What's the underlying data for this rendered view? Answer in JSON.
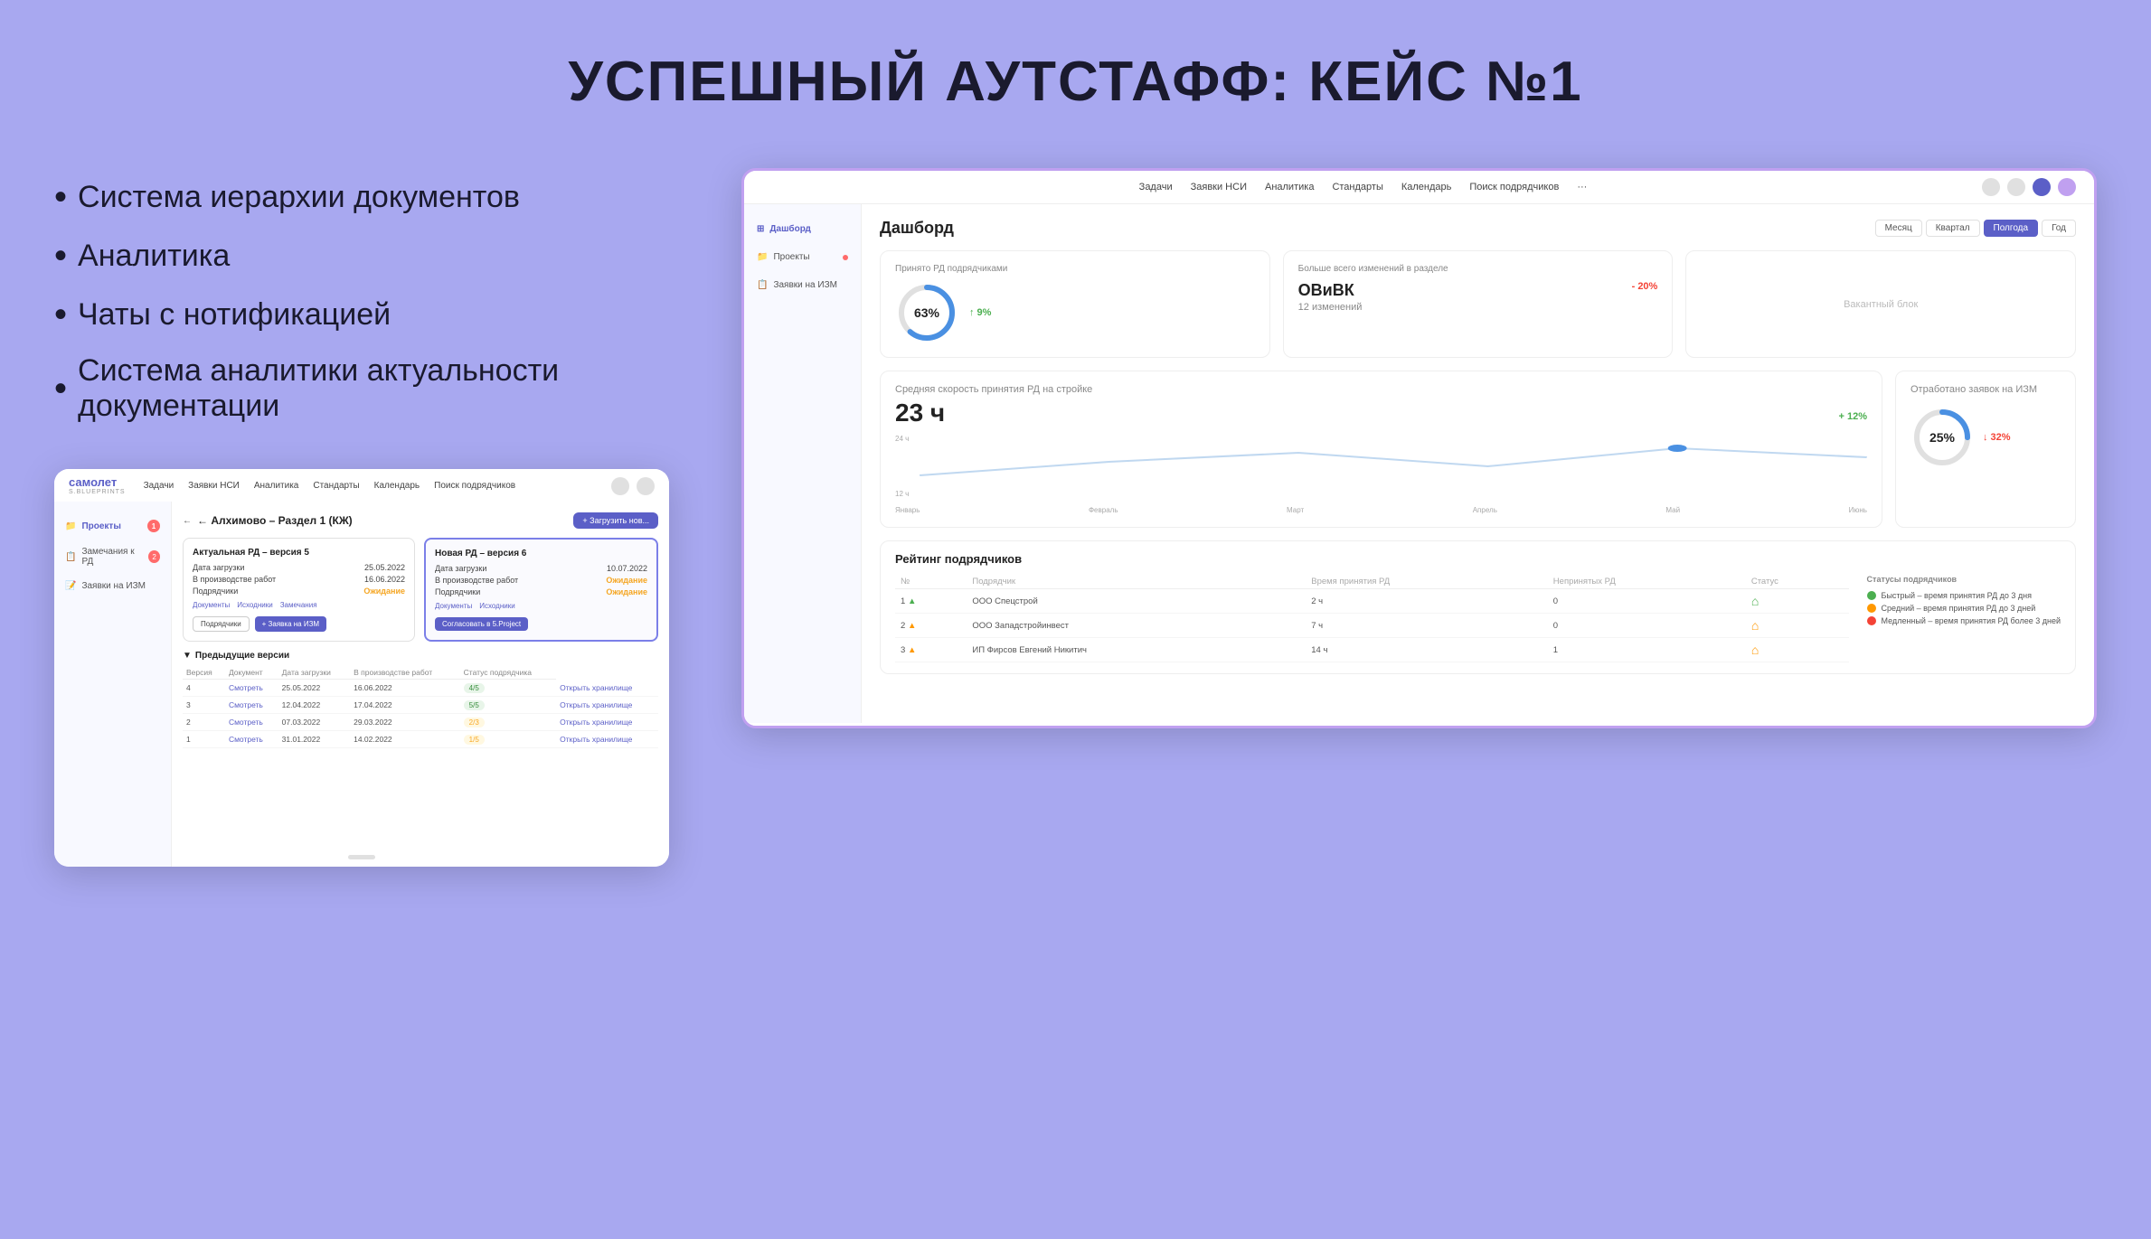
{
  "page": {
    "title": "УСПЕШНЫЙ АУТСТАФФ: КЕЙС №1",
    "background_color": "#a8a8f0"
  },
  "bullets": [
    "Система иерархии документов",
    "Аналитика",
    "Чаты с нотификацией",
    "Система аналитики актуальности документации"
  ],
  "left_app": {
    "logo": {
      "main": "самолет",
      "sub": "S.BLUEPRINTS"
    },
    "nav_items": [
      "Задачи",
      "Заявки НСИ",
      "Аналитика",
      "Стандарты",
      "Календарь",
      "Поиск подрядчиков"
    ],
    "sidebar_items": [
      {
        "label": "Проекты",
        "active": true,
        "badge": "1"
      },
      {
        "label": "Замечания к РД",
        "badge": "2"
      },
      {
        "label": "Заявки на ИЗМ",
        "badge": null
      }
    ],
    "breadcrumb": "← Алхимово – Раздел 1 (КЖ)",
    "upload_button": "+ Загрузить нов...",
    "current_rd": {
      "title": "Актуальная РД – версия 5",
      "upload_date_label": "Дата загрузки",
      "upload_date": "25.05.2022",
      "in_production_label": "В производстве работ",
      "in_production_date": "16.06.2022",
      "subcontractors_label": "Подрядчики",
      "subcontractors_status": "Ожидание",
      "links": [
        "Документы",
        "Исходники",
        "Замечания"
      ],
      "buttons": [
        "Подрядчики",
        "+ Заявка на ИЗМ"
      ]
    },
    "new_rd": {
      "title": "Новая РД – версия 6",
      "upload_date_label": "Дата загрузки",
      "upload_date": "10.07.2022",
      "in_production_label": "В производстве работ",
      "in_production_status": "Ожидание",
      "subcontractors_label": "Подрядчики",
      "subcontractors_status": "Ожидание",
      "links": [
        "Документы",
        "Исходники"
      ],
      "button": "Согласовать в 5.Project"
    },
    "prev_versions": {
      "title": "Предыдущие версии",
      "columns": [
        "Версия",
        "Документ",
        "Дата загрузки",
        "В производстве работ",
        "Статус подрядчика"
      ],
      "rows": [
        {
          "ver": "4",
          "doc": "Смотреть",
          "date": "25.05.2022",
          "prod_date": "16.06.2022",
          "status": "4/5",
          "status_color": "green",
          "action": "Открыть хранилище"
        },
        {
          "ver": "3",
          "doc": "Смотреть",
          "date": "12.04.2022",
          "prod_date": "17.04.2022",
          "status": "5/5",
          "status_color": "green",
          "action": "Открыть хранилище"
        },
        {
          "ver": "2",
          "doc": "Смотреть",
          "date": "07.03.2022",
          "prod_date": "29.03.2022",
          "status": "2/3",
          "status_color": "yellow",
          "action": "Открыть хранилище"
        },
        {
          "ver": "1",
          "doc": "Смотреть",
          "date": "31.01.2022",
          "prod_date": "14.02.2022",
          "status": "1/5",
          "status_color": "yellow",
          "action": "Открыть хранилище"
        }
      ]
    }
  },
  "right_app": {
    "nav_items": [
      "Задачи",
      "Заявки НСИ",
      "Аналитика",
      "Стандарты",
      "Календарь",
      "Поиск подрядчиков"
    ],
    "sidebar_items": [
      {
        "label": "Дашборд",
        "active": true
      },
      {
        "label": "Проекты",
        "has_dot": false
      },
      {
        "label": "Заявки на ИЗМ",
        "has_dot": true
      }
    ],
    "dashboard_title": "Дашборд",
    "period_buttons": [
      "Месяц",
      "Квартал",
      "Полгода",
      "Год"
    ],
    "active_period": "Полгода",
    "stat_accepted": {
      "label": "Принято РД подрядчиками",
      "percent": 63,
      "delta": "↑ 9%",
      "delta_color": "green"
    },
    "stat_changes": {
      "label": "Больше всего изменений в разделе",
      "section": "ОВиВК",
      "delta": "- 20%",
      "delta_color": "red",
      "count": "12 изменений"
    },
    "stat_vacant": {
      "label": "Вакантный блок"
    },
    "chart_speed": {
      "label": "Средняя скорость принятия РД на стройке",
      "value": "23 ч",
      "delta": "+ 12%",
      "delta_color": "green",
      "months": [
        "Январь",
        "Февраль",
        "Март",
        "Апрель",
        "Май",
        "Июнь"
      ],
      "y_labels": [
        "24 ч",
        "12 ч"
      ]
    },
    "chart_processed": {
      "label": "Отработано заявок на ИЗМ",
      "percent": 25,
      "delta": "↓ 32%",
      "delta_color": "red"
    },
    "rating": {
      "title": "Рейтинг подрядчиков",
      "columns": [
        "№",
        "Подрядчик",
        "Время принятия РД",
        "Непринятых РД",
        "Статус",
        "Статусы подрядчиков"
      ],
      "rows": [
        {
          "num": "1",
          "company": "ООО Спецстрой",
          "time": "2 ч",
          "rejected": "0",
          "speed": "fast"
        },
        {
          "num": "2",
          "company": "ООО Западстройинвест",
          "time": "7 ч",
          "rejected": "0",
          "speed": "medium"
        },
        {
          "num": "3",
          "company": "ИП Фирсов Евгений Никитич",
          "time": "14 ч",
          "rejected": "1",
          "speed": "medium"
        }
      ],
      "legend": [
        {
          "label": "Быстрый – время принятия РД до 3 дня",
          "color": "fast"
        },
        {
          "label": "Средний – время принятия РД до 3 дней",
          "color": "medium"
        },
        {
          "label": "Медленный – время принятия РД более 3 дней",
          "color": "slow"
        }
      ]
    }
  }
}
